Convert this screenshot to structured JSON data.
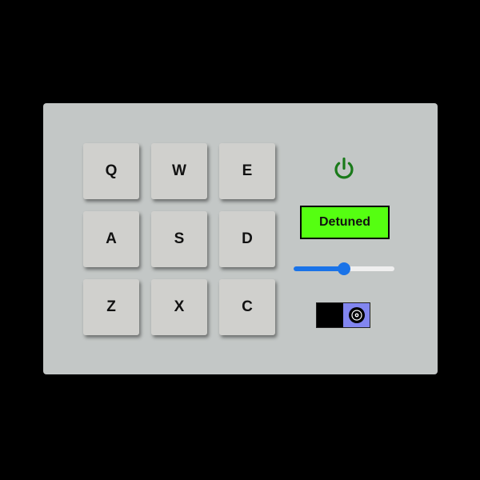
{
  "pads": [
    {
      "key": "Q"
    },
    {
      "key": "W"
    },
    {
      "key": "E"
    },
    {
      "key": "A"
    },
    {
      "key": "S"
    },
    {
      "key": "D"
    },
    {
      "key": "Z"
    },
    {
      "key": "X"
    },
    {
      "key": "C"
    }
  ],
  "controls": {
    "power": {
      "on": true,
      "icon": "power-icon",
      "color": "#1a7a1a"
    },
    "display": {
      "text": "Detuned",
      "background": "#55ff11"
    },
    "volume": {
      "value": 0.5
    },
    "bank_toggle": {
      "icon": "vinyl-record-icon",
      "knob_color": "#8286f0"
    }
  },
  "colors": {
    "page_background": "#000000",
    "panel": "#c3c7c6",
    "pad": "#d0d0cd",
    "slider_accent": "#1a73e8"
  }
}
